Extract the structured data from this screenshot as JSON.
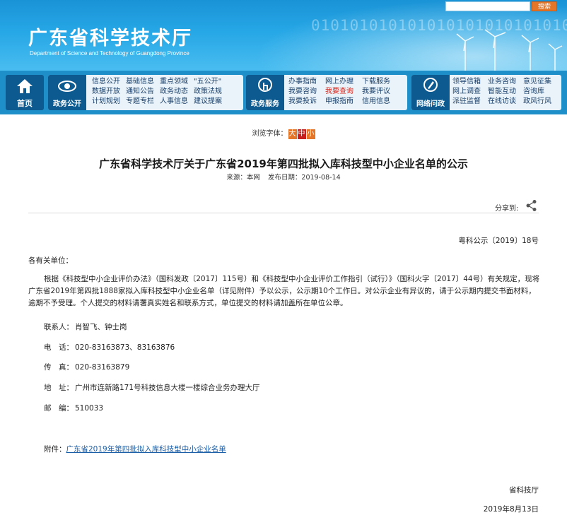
{
  "header": {
    "site_title": "广东省科学技术厅",
    "site_subtitle": "Department of Science and Technology of Guangdong Province",
    "binary_deco": "01010101010101010101010101010",
    "search_button": "搜索"
  },
  "nav": {
    "home": "首页",
    "groups": [
      {
        "title": "政务公开",
        "icon": "eye-icon",
        "links": [
          "信息公开",
          "基础信息",
          "重点领域",
          "\"五公开\"",
          "数据开放",
          "通知公告",
          "政务动态",
          "政策法规",
          "计划规划",
          "专题专栏",
          "人事信息",
          "建议提案"
        ]
      },
      {
        "title": "政务服务",
        "icon": "touch-icon",
        "links": [
          "办事指南",
          "网上办理",
          "下载服务",
          "我要咨询",
          "我要查询",
          "我要评议",
          "我要投诉",
          "申报指南",
          "信用信息"
        ]
      },
      {
        "title": "网络问政",
        "icon": "pen-icon",
        "links": [
          "领导信箱",
          "业务咨询",
          "意见征集",
          "网上调查",
          "智能互动",
          "咨询库",
          "派驻监督",
          "在线访谈",
          "政风行风"
        ]
      }
    ],
    "hot_link": "我要查询"
  },
  "font_size": {
    "label": "浏览字体：",
    "big": "大",
    "mid": "中",
    "small": "小"
  },
  "article": {
    "title": "广东省科学技术厅关于广东省2019年第四批拟入库科技型中小企业名单的公示",
    "source_label": "来源：",
    "source": "本网",
    "date_label": "发布日期：",
    "date": "2019-08-14",
    "share_label": "分享到:",
    "doc_no": "粤科公示〔2019〕18号",
    "salutation": "各有关单位：",
    "body": "根据《科技型中小企业评价办法》（国科发政〔2017〕115号）和《科技型中小企业评价工作指引（试行）》（国科火字〔2017〕44号）有关规定，现将广东省2019年第四批1888家拟入库科技型中小企业名单（详见附件）予以公示，公示期10个工作日。对公示企业有异议的，请于公示期内提交书面材料，逾期不予受理。个人提交的材料请署真实姓名和联系方式，单位提交的材料请加盖所在单位公章。",
    "contacts": [
      {
        "key": "联系人：",
        "value": "肖智飞、钟士岗"
      },
      {
        "key": "电　话：",
        "value": "020-83163873、83163876"
      },
      {
        "key": "传　真：",
        "value": "020-83163879"
      },
      {
        "key": "地　址：",
        "value": "广州市连新路171号科技信息大楼一楼综合业务办理大厅"
      },
      {
        "key": "邮　编：",
        "value": "510033"
      }
    ],
    "attachment_label": "附件：",
    "attachment_link": "广东省2019年第四批拟入库科技型中小企业名单",
    "signer": "省科技厅",
    "sign_date": "2019年8月13日"
  },
  "colors": {
    "nav_bg": "#1f8fc9",
    "nav_head": "#0c5a90",
    "accent_orange": "#e4762a",
    "accent_red": "#c81e1e"
  }
}
